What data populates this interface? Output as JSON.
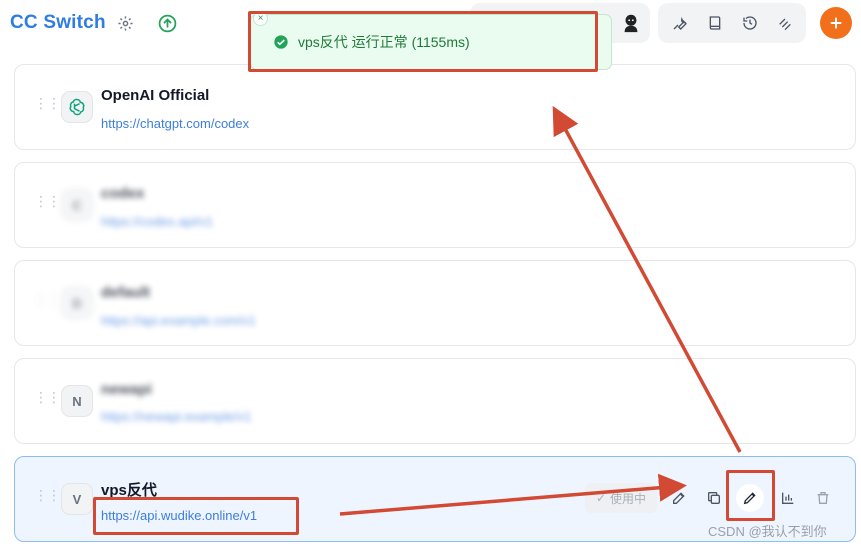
{
  "app": {
    "title": "CC Switch"
  },
  "toast": {
    "message": "vps反代 运行正常 (1155ms)",
    "close": "×"
  },
  "providers": [
    {
      "name": "OpenAI Official",
      "url": "https://chatgpt.com/codex",
      "icon": "openai-logo"
    },
    {
      "name": "codex",
      "url": "https://codex.api/v1",
      "icon": "C"
    },
    {
      "name": "default",
      "url": "https://api.example.com/v1",
      "icon": "D"
    },
    {
      "name": "newapi",
      "url": "https://newapi.example/v1",
      "icon": "N"
    },
    {
      "name": "vps反代",
      "url": "https://api.wudike.online/v1",
      "icon": "V",
      "active": true
    }
  ],
  "actions": {
    "in_use_label": "使用中"
  },
  "watermark": "CSDN @我认不到你",
  "colors": {
    "brand": "#2f7de1",
    "accent": "#f2701c",
    "success": "#22a35a",
    "annotation": "#d24a33"
  }
}
